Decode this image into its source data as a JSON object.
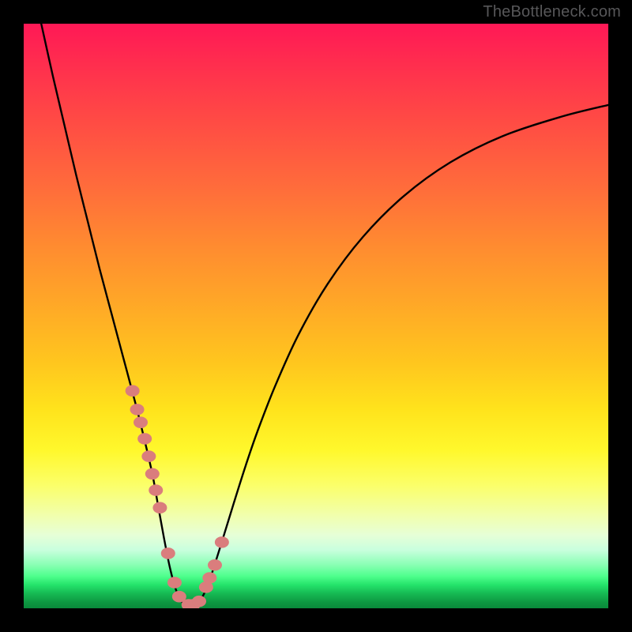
{
  "watermark": "TheBottleneck.com",
  "chart_data": {
    "type": "line",
    "title": "",
    "xlabel": "",
    "ylabel": "",
    "xlim": [
      0,
      100
    ],
    "ylim": [
      0,
      100
    ],
    "series": [
      {
        "name": "curve",
        "x": [
          3,
          5,
          7,
          9,
          11,
          13,
          15,
          17,
          19,
          20.5,
          22,
          23,
          24,
          25,
          26,
          27,
          28,
          29,
          30,
          31,
          32,
          34,
          36,
          38,
          40,
          43,
          47,
          52,
          58,
          65,
          73,
          82,
          92,
          100
        ],
        "y": [
          100,
          91,
          82.5,
          74,
          66,
          58,
          50.5,
          43,
          35.5,
          29.5,
          23,
          17.5,
          12,
          7,
          3.3,
          1.2,
          0.4,
          0.4,
          1.1,
          2.8,
          5.4,
          11.7,
          18.2,
          24.5,
          30.3,
          38.0,
          46.8,
          55.5,
          63.5,
          70.5,
          76.3,
          80.8,
          84.1,
          86.1
        ]
      }
    ],
    "markers": {
      "name": "dots",
      "color": "#da7d7d",
      "x": [
        18.6,
        19.4,
        20.0,
        20.7,
        21.4,
        22.0,
        22.6,
        23.3,
        24.7,
        25.8,
        26.6,
        28.2,
        29.0,
        30.0,
        31.2,
        31.8,
        32.7,
        33.9
      ],
      "y": [
        37.2,
        34.0,
        31.8,
        29.0,
        26.0,
        23.0,
        20.2,
        17.2,
        9.4,
        4.4,
        2.0,
        0.6,
        0.6,
        1.2,
        3.6,
        5.2,
        7.4,
        11.3
      ]
    }
  }
}
